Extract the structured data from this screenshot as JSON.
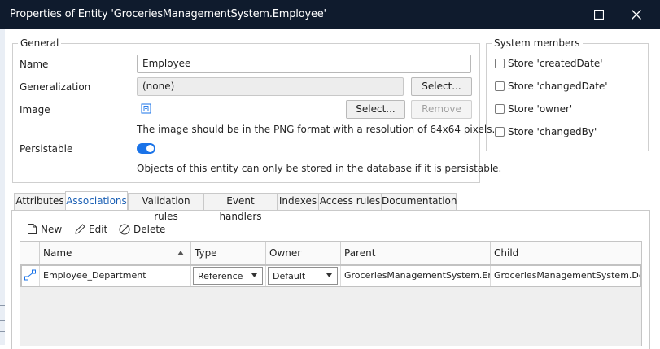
{
  "window": {
    "title": "Properties of Entity 'GroceriesManagementSystem.Employee'"
  },
  "general": {
    "group_title": "General",
    "name_label": "Name",
    "name_value": "Employee",
    "generalization_label": "Generalization",
    "generalization_value": "(none)",
    "select_label": "Select...",
    "image_label": "Image",
    "image_select_label": "Select...",
    "image_remove_label": "Remove",
    "image_hint": "The image should be in the PNG format with a resolution of 64x64 pixels.",
    "persistable_label": "Persistable",
    "persistable_on": true,
    "persistable_hint": "Objects of this entity can only be stored in the database if it is persistable."
  },
  "system_members": {
    "group_title": "System members",
    "items": [
      {
        "label": "Store 'createdDate'",
        "checked": false
      },
      {
        "label": "Store 'changedDate'",
        "checked": false
      },
      {
        "label": "Store 'owner'",
        "checked": false
      },
      {
        "label": "Store 'changedBy'",
        "checked": false
      }
    ]
  },
  "tabs": [
    {
      "label": "Attributes",
      "active": false
    },
    {
      "label": "Associations",
      "active": true
    },
    {
      "label": "Validation rules",
      "active": false
    },
    {
      "label": "Event handlers",
      "active": false
    },
    {
      "label": "Indexes",
      "active": false
    },
    {
      "label": "Access rules",
      "active": false
    },
    {
      "label": "Documentation",
      "active": false
    }
  ],
  "toolbar": {
    "new_label": "New",
    "edit_label": "Edit",
    "delete_label": "Delete"
  },
  "grid": {
    "columns": [
      "Name",
      "Type",
      "Owner",
      "Parent",
      "Child"
    ],
    "sort_column": "Name",
    "rows": [
      {
        "name": "Employee_Department",
        "type": "Reference",
        "owner": "Default",
        "parent": "GroceriesManagementSystem.Em...",
        "child": "GroceriesManagementSystem.Dep..."
      }
    ]
  },
  "colors": {
    "titlebar": "#0f1b2d",
    "accent": "#1a73e8",
    "active_tab_text": "#1a5fb4"
  }
}
